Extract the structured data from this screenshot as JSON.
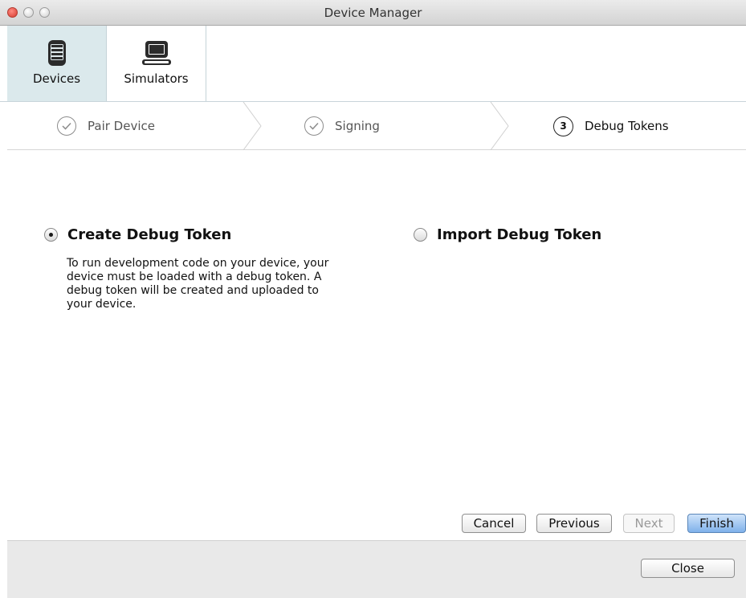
{
  "window": {
    "title": "Device Manager"
  },
  "toolbar": {
    "items": [
      {
        "label": "Devices",
        "icon": "phone-icon",
        "selected": true
      },
      {
        "label": "Simulators",
        "icon": "laptop-icon",
        "selected": false
      }
    ]
  },
  "steps": [
    {
      "number": "",
      "label": "Pair Device",
      "status": "complete"
    },
    {
      "number": "",
      "label": "Signing",
      "status": "complete"
    },
    {
      "number": "3",
      "label": "Debug Tokens",
      "status": "current"
    }
  ],
  "options": {
    "create": {
      "label": "Create Debug Token",
      "selected": true,
      "description": "To run development code on your device, your device must be loaded with a debug token. A debug token will be created and uploaded to your device."
    },
    "import": {
      "label": "Import Debug Token",
      "selected": false
    }
  },
  "buttons": {
    "cancel": "Cancel",
    "previous": "Previous",
    "next": "Next",
    "finish": "Finish",
    "close": "Close"
  }
}
